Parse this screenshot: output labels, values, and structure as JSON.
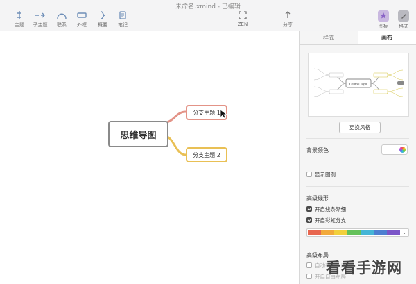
{
  "window_title": "未命名.xmind - 已编辑",
  "toolbar": {
    "topic": "主题",
    "subtopic": "子主题",
    "relationship": "联系",
    "boundary": "外框",
    "summary": "概要",
    "note": "笔记",
    "zen": "ZEN",
    "share": "分享",
    "icons": "图标",
    "format": "格式"
  },
  "mindmap": {
    "central": "思维导图",
    "branch1": "分支主题 1",
    "branch2": "分支主题 2",
    "branch1_color": "#e39387",
    "branch2_color": "#e9c055"
  },
  "panel": {
    "tab_style": "样式",
    "tab_canvas": "画布",
    "preview_central": "Central Topic",
    "change_theme": "更换风格",
    "bg_color_label": "背景颜色",
    "show_legend": "显示图例",
    "advanced_lines": "高级线形",
    "tapered_lines": "开启线条渐细",
    "rainbow_branches": "开启彩虹分支",
    "advanced_layout": "高级布局",
    "layout_opt1": "自动平衡布局",
    "layout_opt2": "开启自由布局",
    "rainbow_colors": [
      "#e8664f",
      "#f2a93b",
      "#f2d03c",
      "#64c15a",
      "#45b5d6",
      "#4d7fd1",
      "#7b55c8",
      "#c25aa8"
    ]
  },
  "watermark": "看看手游网"
}
